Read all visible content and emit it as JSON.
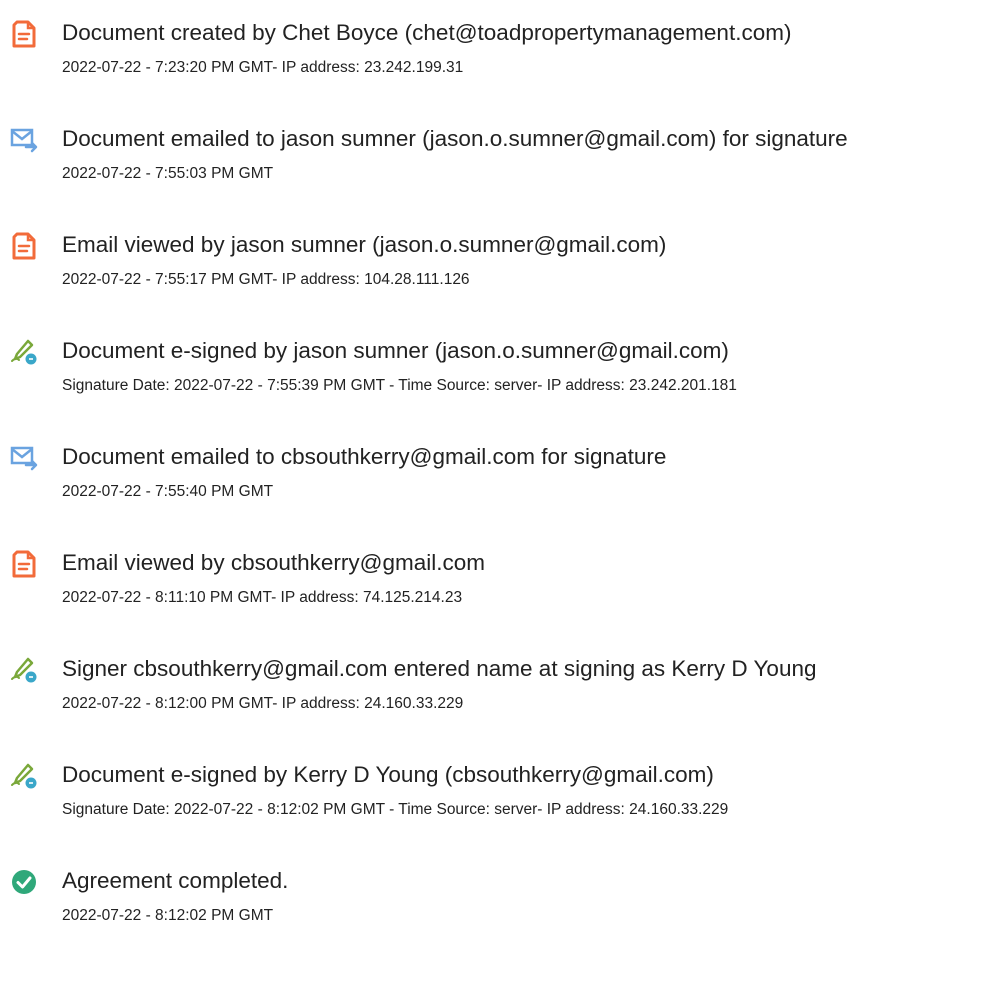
{
  "events": [
    {
      "icon": "document-icon",
      "title": "Document created by Chet Boyce (chet@toadpropertymanagement.com)",
      "detail": "2022-07-22 - 7:23:20 PM GMT- IP address: 23.242.199.31"
    },
    {
      "icon": "email-sent-icon",
      "title": "Document emailed to jason sumner (jason.o.sumner@gmail.com) for signature",
      "detail": "2022-07-22 - 7:55:03 PM GMT"
    },
    {
      "icon": "document-icon",
      "title": "Email viewed by jason sumner (jason.o.sumner@gmail.com)",
      "detail": "2022-07-22 - 7:55:17 PM GMT- IP address: 104.28.111.126"
    },
    {
      "icon": "esign-pen-icon",
      "title": "Document e-signed by jason sumner (jason.o.sumner@gmail.com)",
      "detail": "Signature Date: 2022-07-22 - 7:55:39 PM GMT - Time Source: server- IP address: 23.242.201.181"
    },
    {
      "icon": "email-sent-icon",
      "title": "Document emailed to cbsouthkerry@gmail.com for signature",
      "detail": "2022-07-22 - 7:55:40 PM GMT"
    },
    {
      "icon": "document-icon",
      "title": "Email viewed by cbsouthkerry@gmail.com",
      "detail": "2022-07-22 - 8:11:10 PM GMT- IP address: 74.125.214.23"
    },
    {
      "icon": "esign-pen-icon",
      "title": "Signer cbsouthkerry@gmail.com entered name at signing as Kerry D Young",
      "detail": "2022-07-22 - 8:12:00 PM GMT- IP address: 24.160.33.229"
    },
    {
      "icon": "esign-pen-icon",
      "title": "Document e-signed by Kerry D Young (cbsouthkerry@gmail.com)",
      "detail": "Signature Date: 2022-07-22 - 8:12:02 PM GMT - Time Source: server- IP address: 24.160.33.229"
    },
    {
      "icon": "checkmark-icon",
      "title": "Agreement completed.",
      "detail": "2022-07-22 - 8:12:02 PM GMT"
    }
  ],
  "colors": {
    "document_icon": "#f26b3a",
    "email_icon": "#6aa3e0",
    "pen_icon": "#7aa83a",
    "pen_badge": "#3aa7c9",
    "check_icon": "#2fa87a",
    "text": "#222222"
  }
}
